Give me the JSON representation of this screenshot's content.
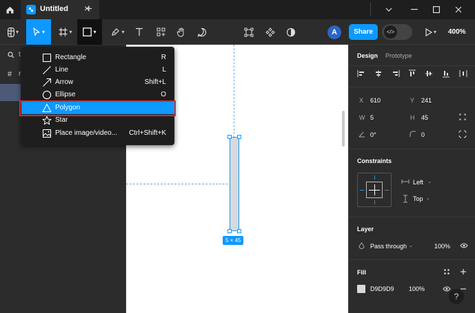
{
  "tab": {
    "title": "Untitled"
  },
  "toolbar": {
    "avatar_initial": "A",
    "share_label": "Share",
    "zoom": "400%"
  },
  "left_panel": {
    "search_fragment": "t",
    "layers_fragment": "r"
  },
  "canvas": {
    "dimension_badge": "5 × 45"
  },
  "shape_menu": {
    "items": [
      {
        "label": "Rectangle",
        "shortcut": "R",
        "icon": "rectangle-icon"
      },
      {
        "label": "Line",
        "shortcut": "L",
        "icon": "line-icon"
      },
      {
        "label": "Arrow",
        "shortcut": "Shift+L",
        "icon": "arrow-icon"
      },
      {
        "label": "Ellipse",
        "shortcut": "O",
        "icon": "ellipse-icon"
      },
      {
        "label": "Polygon",
        "shortcut": "",
        "icon": "polygon-icon"
      },
      {
        "label": "Star",
        "shortcut": "",
        "icon": "star-icon"
      },
      {
        "label": "Place image/video...",
        "shortcut": "Ctrl+Shift+K",
        "icon": "image-icon"
      }
    ],
    "highlighted": "Polygon"
  },
  "right_panel": {
    "tabs": {
      "design": "Design",
      "prototype": "Prototype"
    },
    "x_label": "X",
    "x_value": "610",
    "y_label": "Y",
    "y_value": "241",
    "w_label": "W",
    "w_value": "5",
    "h_label": "H",
    "h_value": "45",
    "rotation": "0°",
    "radius": "0",
    "constraints": {
      "title": "Constraints",
      "horizontal": "Left",
      "vertical": "Top"
    },
    "layer": {
      "title": "Layer",
      "blend": "Pass through",
      "opacity": "100%"
    },
    "fill": {
      "title": "Fill",
      "hex": "D9D9D9",
      "opacity": "100%"
    },
    "help": "?"
  },
  "colors": {
    "accent": "#0d99ff",
    "highlight_border": "#e4252c",
    "fill_swatch": "#d9d9d9"
  }
}
